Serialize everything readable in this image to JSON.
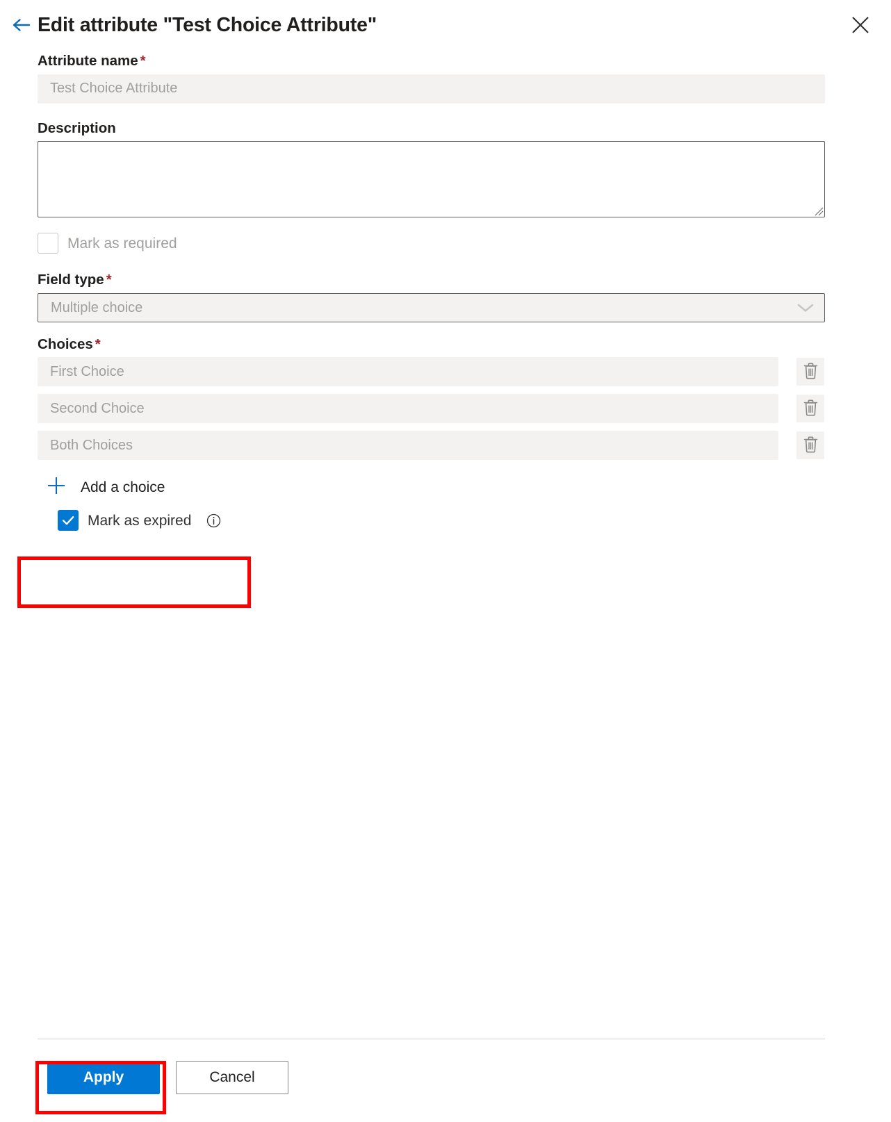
{
  "header": {
    "title": "Edit attribute \"Test Choice Attribute\"",
    "back_icon": "back-arrow-icon",
    "close_icon": "close-icon"
  },
  "form": {
    "attribute_name": {
      "label": "Attribute name",
      "required_marker": "*",
      "value": "",
      "placeholder": "Test Choice Attribute"
    },
    "description": {
      "label": "Description",
      "value": "",
      "placeholder": ""
    },
    "mark_as_required": {
      "label": "Mark as required",
      "checked": false,
      "disabled": true
    },
    "field_type": {
      "label": "Field type",
      "required_marker": "*",
      "selected": "Multiple choice",
      "options": [
        "Multiple choice"
      ],
      "chevron_icon": "chevron-down-icon"
    },
    "choices": {
      "label": "Choices",
      "required_marker": "*",
      "items": [
        {
          "placeholder": "First Choice",
          "value": "",
          "delete_icon": "trash-icon"
        },
        {
          "placeholder": "Second Choice",
          "value": "",
          "delete_icon": "trash-icon"
        },
        {
          "placeholder": "Both Choices",
          "value": "",
          "delete_icon": "trash-icon"
        }
      ],
      "add_label": "Add a choice",
      "add_icon": "plus-icon"
    },
    "mark_as_expired": {
      "label": "Mark as expired",
      "checked": true,
      "info_icon": "info-icon"
    }
  },
  "footer": {
    "apply_label": "Apply",
    "cancel_label": "Cancel"
  },
  "colors": {
    "accent": "#0078d4",
    "required_star": "#a4262c",
    "annotation": "#ff0000",
    "field_bg": "#f3f2f1",
    "border_dark": "#605e5c",
    "placeholder": "#a19f9d"
  }
}
